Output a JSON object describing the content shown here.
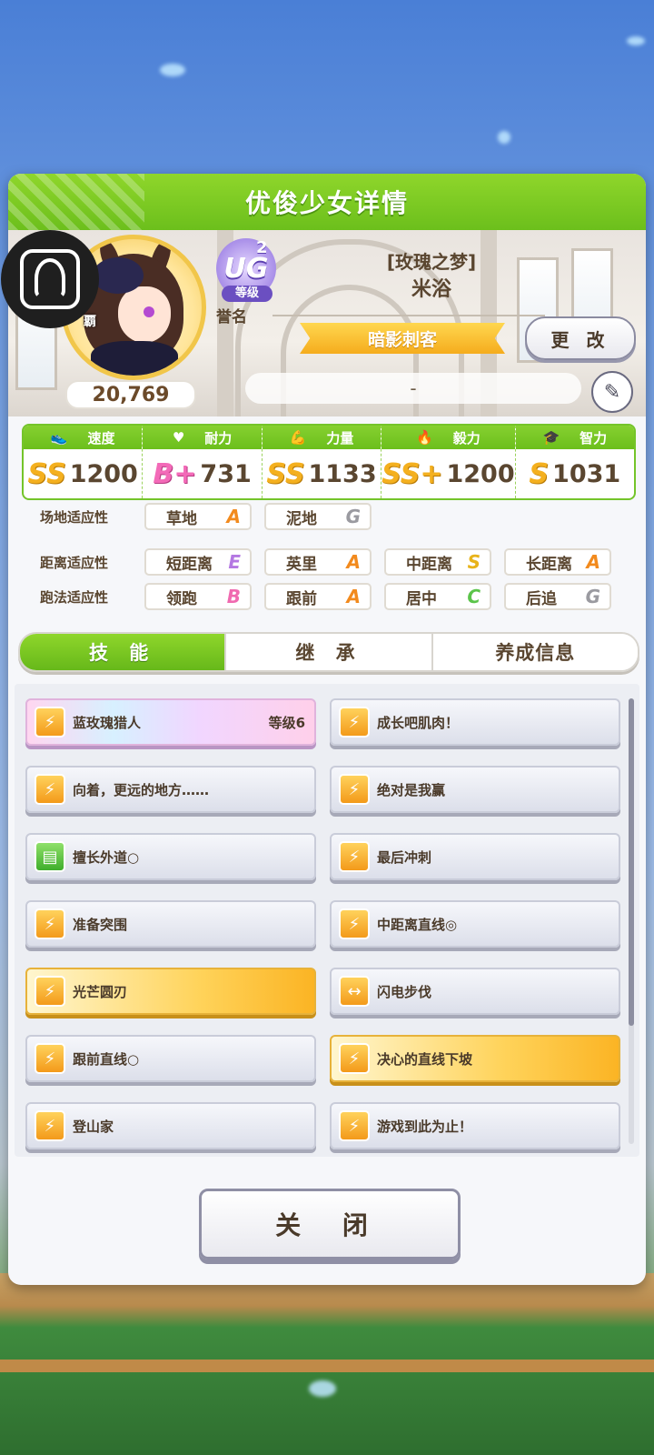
{
  "panel": {
    "title": "优俊少女详情"
  },
  "profile": {
    "rank_letters": "UG",
    "rank_sup": "2",
    "rank_label": "等级",
    "honor_label": "誉名",
    "epithet": "[玫瑰之梦]",
    "name": "米浴",
    "title": "暗影刺客",
    "change_label": "更 改",
    "comment": "-",
    "fans": "20,769",
    "side_tag": "覇"
  },
  "stats": [
    {
      "label": "速度",
      "icon": "shoe-icon",
      "grade": "SS",
      "value": "1200",
      "color": "#f4b01f"
    },
    {
      "label": "耐力",
      "icon": "heart-icon",
      "grade": "B+",
      "value": "731",
      "color": "#f36ab8"
    },
    {
      "label": "力量",
      "icon": "muscle-icon",
      "grade": "SS",
      "value": "1133",
      "color": "#f4b01f"
    },
    {
      "label": "毅力",
      "icon": "flame-icon",
      "grade": "SS+",
      "value": "1200",
      "color": "#f4b01f"
    },
    {
      "label": "智力",
      "icon": "graduation-cap-icon",
      "grade": "S",
      "value": "1031",
      "color": "#f4b01f"
    }
  ],
  "aptitude": {
    "track_label": "场地适应性",
    "track": [
      {
        "name": "草地",
        "grade": "A"
      },
      {
        "name": "泥地",
        "grade": "G"
      }
    ],
    "distance_label": "距离适应性",
    "distance": [
      {
        "name": "短距离",
        "grade": "E"
      },
      {
        "name": "英里",
        "grade": "A"
      },
      {
        "name": "中距离",
        "grade": "S"
      },
      {
        "name": "长距离",
        "grade": "A"
      }
    ],
    "style_label": "跑法适应性",
    "style": [
      {
        "name": "领跑",
        "grade": "B"
      },
      {
        "name": "跟前",
        "grade": "A"
      },
      {
        "name": "居中",
        "grade": "C"
      },
      {
        "name": "后追",
        "grade": "G"
      }
    ]
  },
  "tabs": [
    "技 能",
    "继 承",
    "养成信息"
  ],
  "skills": [
    {
      "name": "蓝玫瑰猎人",
      "level": "等级6",
      "style": "rainbow",
      "icon": "speed-icon"
    },
    {
      "name": "成长吧肌肉！",
      "level": "",
      "style": "normal",
      "icon": "speed-icon"
    },
    {
      "name": "向着，更远的地方……",
      "level": "",
      "style": "normal",
      "icon": "speed-icon"
    },
    {
      "name": "绝对是我赢",
      "level": "",
      "style": "normal",
      "icon": "speed-icon"
    },
    {
      "name": "擅长外道○",
      "level": "",
      "style": "normal",
      "icon": "card-icon"
    },
    {
      "name": "最后冲刺",
      "level": "",
      "style": "normal",
      "icon": "speed-icon"
    },
    {
      "name": "准备突围",
      "level": "",
      "style": "normal",
      "icon": "speed-icon"
    },
    {
      "name": "中距离直线◎",
      "level": "",
      "style": "normal",
      "icon": "speed-icon"
    },
    {
      "name": "光芒圆刃",
      "level": "",
      "style": "gold",
      "icon": "speed-icon"
    },
    {
      "name": "闪电步伐",
      "level": "",
      "style": "normal",
      "icon": "arrow-icon"
    },
    {
      "name": "跟前直线○",
      "level": "",
      "style": "normal",
      "icon": "speed-icon"
    },
    {
      "name": "决心的直线下坡",
      "level": "",
      "style": "gold",
      "icon": "speed-icon"
    },
    {
      "name": "登山家",
      "level": "",
      "style": "normal",
      "icon": "speed-icon"
    },
    {
      "name": "游戏到此为止！",
      "level": "",
      "style": "normal",
      "icon": "speed-icon"
    }
  ],
  "close_label": "关 闭"
}
